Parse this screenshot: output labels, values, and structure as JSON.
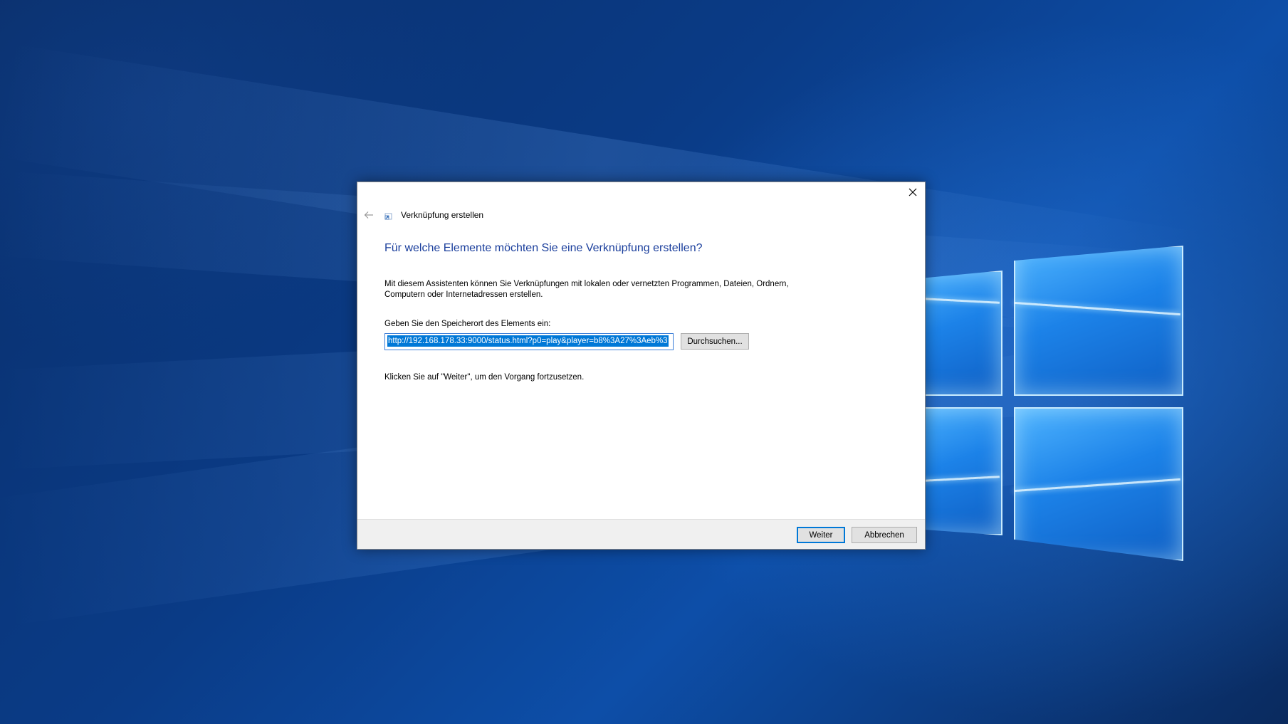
{
  "dialog": {
    "title": "Verknüpfung erstellen",
    "heading": "Für welche Elemente möchten Sie eine Verknüpfung erstellen?",
    "description": "Mit diesem Assistenten können Sie Verknüpfungen mit lokalen oder vernetzten Programmen, Dateien, Ordnern, Computern oder Internetadressen erstellen.",
    "location_label": "Geben Sie den Speicherort des Elements ein:",
    "location_value": "http://192.168.178.33:9000/status.html?p0=play&player=b8%3A27%3Aeb%3",
    "browse_label": "Durchsuchen...",
    "continue_hint": "Klicken Sie auf \"Weiter\", um den Vorgang fortzusetzen.",
    "next_label": "Weiter",
    "cancel_label": "Abbrechen"
  },
  "icons": {
    "close": "close-icon",
    "back": "back-arrow-icon",
    "app": "shortcut-icon"
  },
  "colors": {
    "heading": "#1a3e9c",
    "selection": "#0078d7",
    "default_button_border": "#0078d7"
  }
}
